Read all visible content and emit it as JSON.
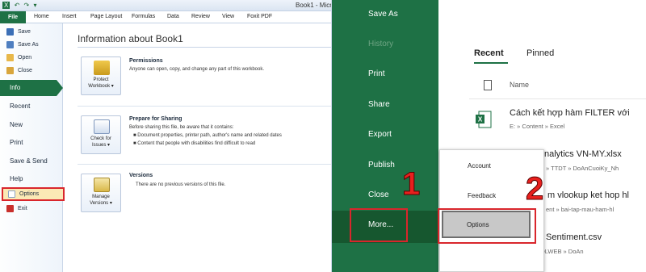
{
  "left": {
    "window_title": "Book1 - Micro",
    "quick_access": [
      "X",
      "↶",
      "↷",
      "▾"
    ],
    "tabs": [
      "File",
      "Home",
      "Insert",
      "Page Layout",
      "Formulas",
      "Data",
      "Review",
      "View",
      "Foxit PDF"
    ],
    "nav": {
      "save": "Save",
      "save_as": "Save As",
      "open": "Open",
      "close": "Close",
      "info": "Info",
      "recent": "Recent",
      "new": "New",
      "print": "Print",
      "save_send": "Save & Send",
      "help": "Help",
      "options": "Options",
      "exit": "Exit"
    },
    "info_title": "Information about Book1",
    "sections": [
      {
        "button": "Protect\nWorkbook ▾",
        "heading": "Permissions",
        "lines": [
          "Anyone can open, copy, and change any part of this workbook."
        ]
      },
      {
        "button": "Check for\nIssues ▾",
        "heading": "Prepare for Sharing",
        "lines": [
          "Before sharing this file, be aware that it contains:",
          "■  Document properties, printer path, author's name and related dates",
          "■  Content that people with disabilities find difficult to read"
        ]
      },
      {
        "button": "Manage\nVersions ▾",
        "heading": "Versions",
        "lines": [
          "There are no previous versions of this file."
        ]
      }
    ],
    "colors": {
      "accent": "#1e7145",
      "highlight": "#d9262c",
      "options_bg": "#fbe9b5"
    }
  },
  "right": {
    "nav": {
      "save_as": "Save As",
      "history": "History",
      "print": "Print",
      "share": "Share",
      "export": "Export",
      "publish": "Publish",
      "close": "Close",
      "more": "More..."
    },
    "tabs": {
      "recent": "Recent",
      "pinned": "Pinned"
    },
    "column_name": "Name",
    "files": [
      {
        "name": "Cách kết hợp hàm FILTER với",
        "path": "E: » Content » Excel"
      },
      {
        "name": "nalytics VN-MY.xlsx",
        "path": "» TTDT » DoAnCuoiKy_Nh"
      },
      {
        "name": "m vlookup ket hop hl",
        "path": "ent » bai-tap-mau-ham-hl"
      },
      {
        "name": "Sentiment.csv",
        "path": "E: » HK6 » DLWEB » DoAn"
      }
    ],
    "popup": {
      "account": "Account",
      "feedback": "Feedback",
      "options": "Options"
    },
    "step_labels": [
      "1",
      "2"
    ],
    "colors": {
      "accent": "#1e7145",
      "more_bg": "#16572f",
      "highlight": "#d9262c"
    }
  }
}
